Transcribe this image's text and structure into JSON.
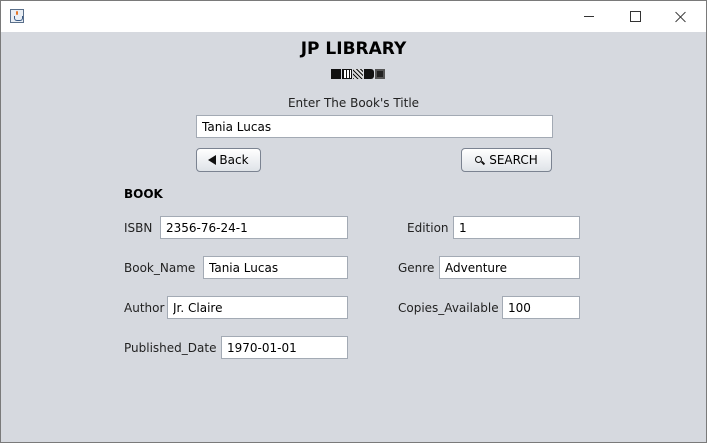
{
  "window": {
    "app_icon": "java-cup-icon",
    "controls": [
      "minimize-icon",
      "maximize-icon",
      "close-icon"
    ]
  },
  "header": {
    "title": "JP LIBRARY",
    "icon": "books-icon"
  },
  "search": {
    "prompt": "Enter The Book's Title",
    "value": "Tania Lucas",
    "back_label": "Back",
    "search_label": "SEARCH"
  },
  "book": {
    "section_title": "BOOK",
    "isbn_label": "ISBN",
    "isbn_value": "2356-76-24-1",
    "name_label": "Book_Name",
    "name_value": "Tania Lucas",
    "author_label": "Author",
    "author_value": "Jr. Claire",
    "date_label": "Published_Date",
    "date_value": "1970-01-01",
    "edition_label": "Edition",
    "edition_value": "1",
    "genre_label": "Genre",
    "genre_value": "Adventure",
    "copies_label": "Copies_Available",
    "copies_value": "100"
  }
}
